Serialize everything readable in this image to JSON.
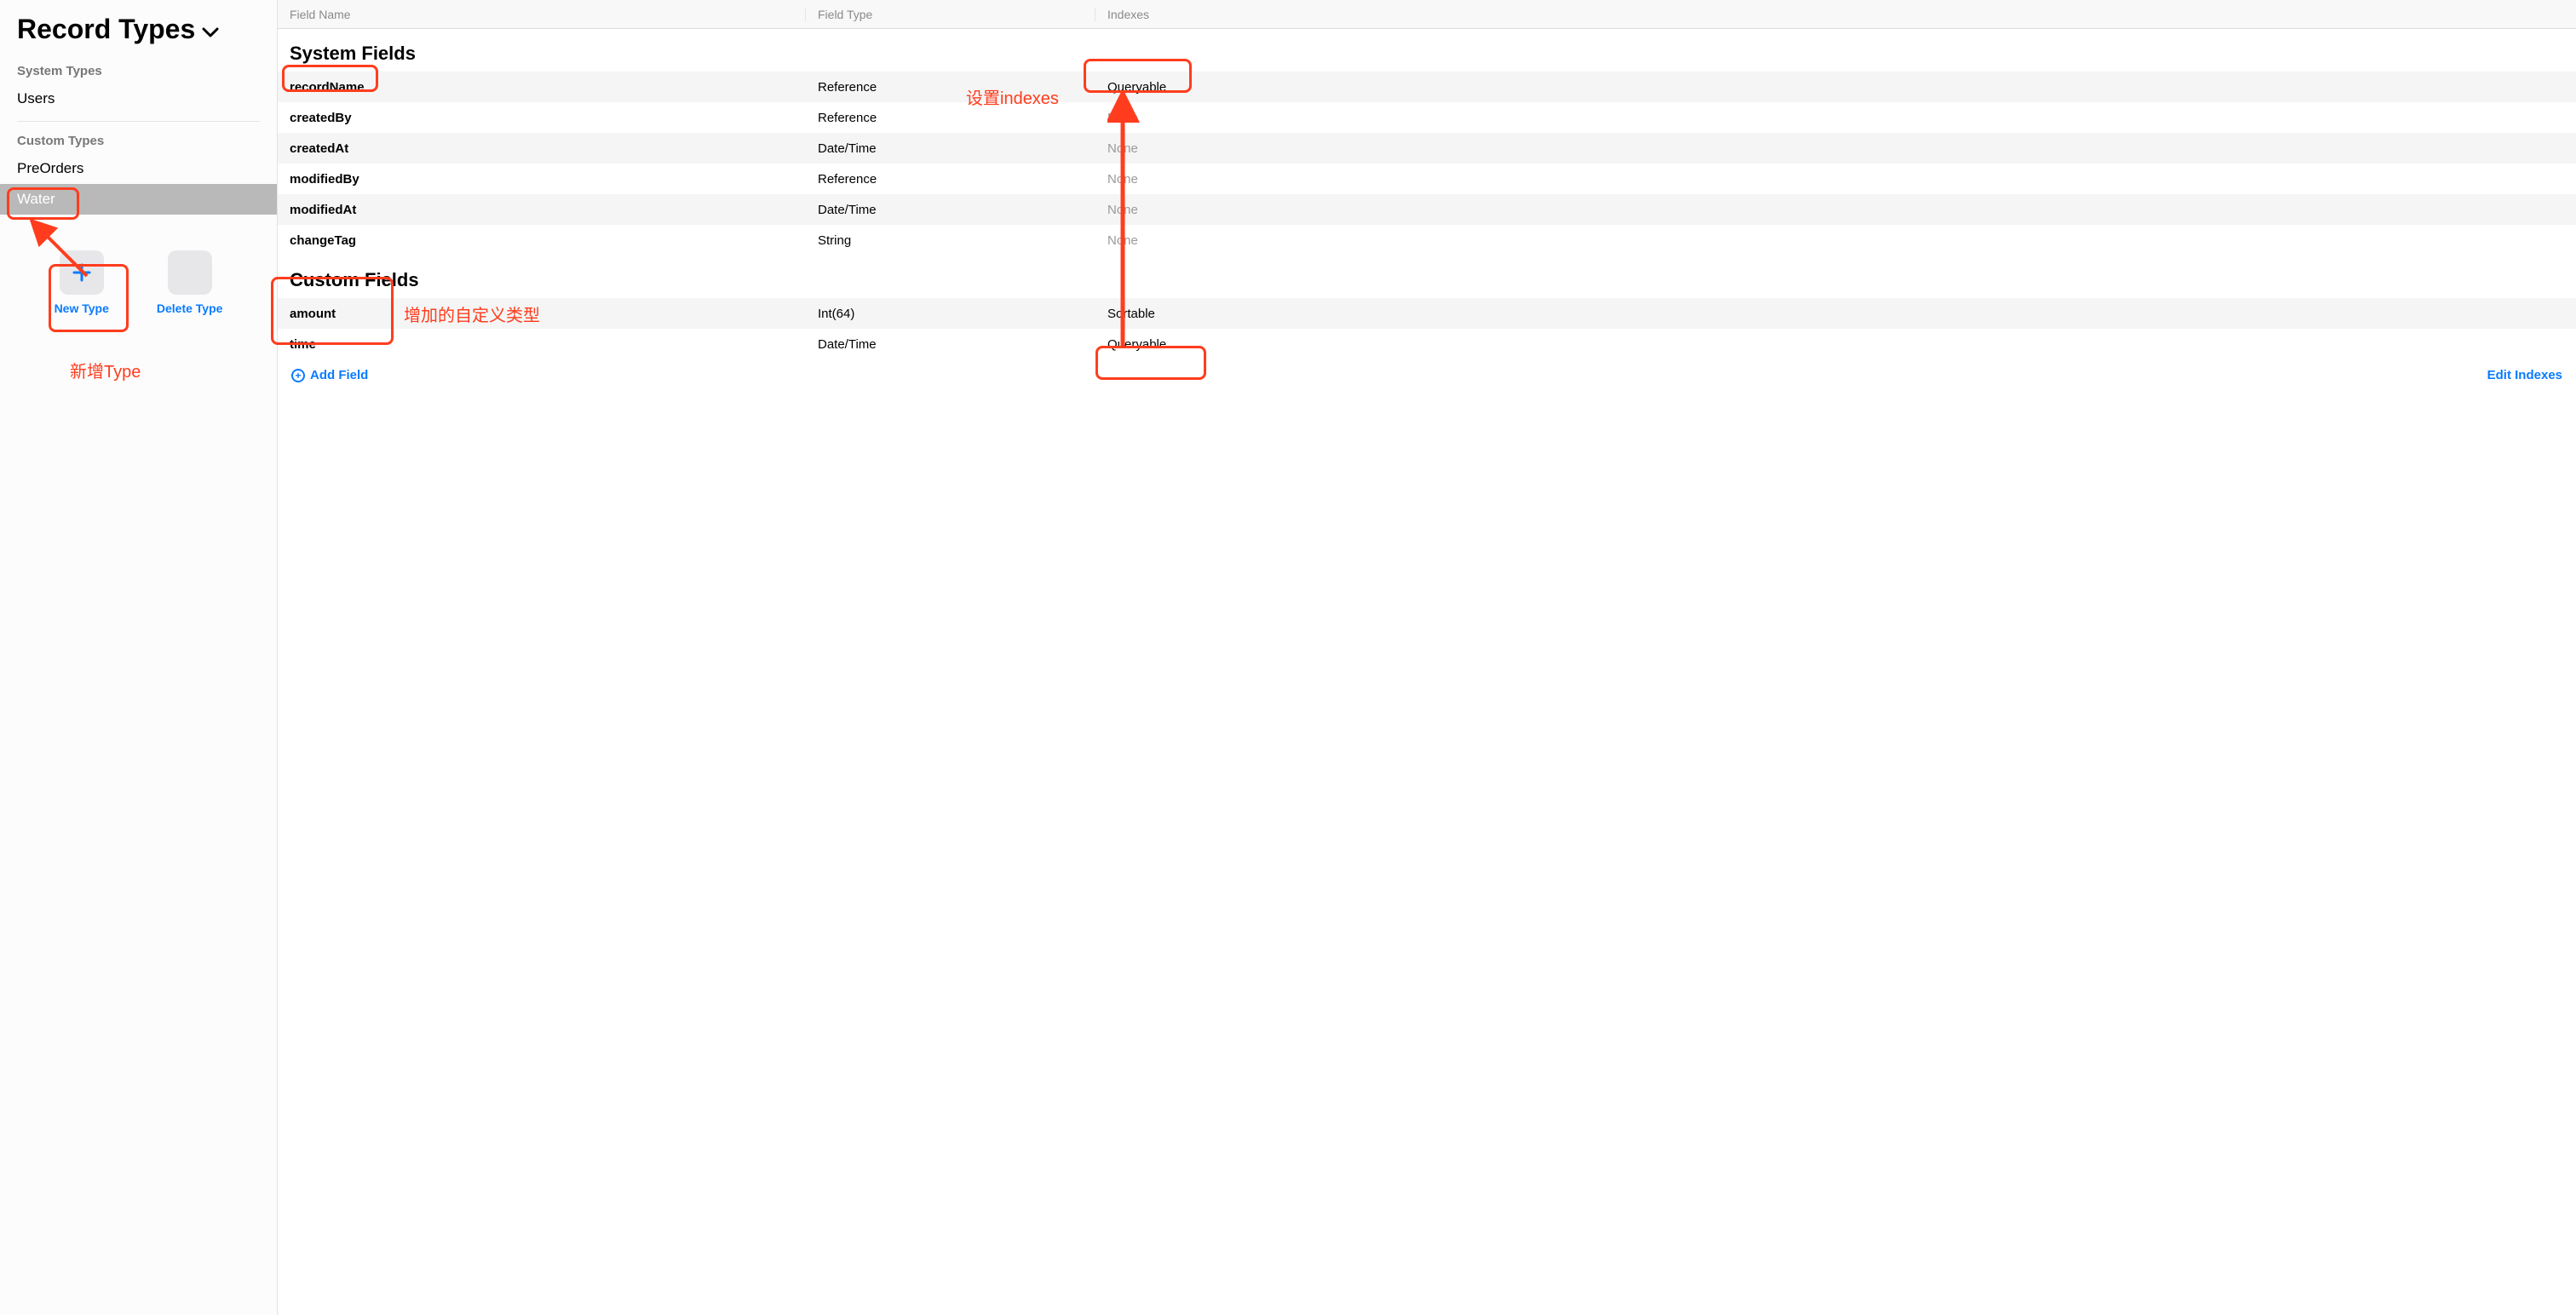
{
  "sidebar": {
    "title": "Record Types",
    "system_types_label": "System Types",
    "system_types": [
      "Users"
    ],
    "custom_types_label": "Custom Types",
    "custom_types": [
      "PreOrders",
      "Water"
    ],
    "selected_type": "Water",
    "actions": {
      "new_type": "New Type",
      "delete_type": "Delete Type"
    }
  },
  "columns": {
    "name": "Field Name",
    "type": "Field Type",
    "indexes": "Indexes"
  },
  "sections": {
    "system": "System Fields",
    "custom": "Custom Fields"
  },
  "system_fields": [
    {
      "name": "recordName",
      "type": "Reference",
      "indexes": "Queryable",
      "muted": false
    },
    {
      "name": "createdBy",
      "type": "Reference",
      "indexes": "None",
      "muted": true
    },
    {
      "name": "createdAt",
      "type": "Date/Time",
      "indexes": "None",
      "muted": true
    },
    {
      "name": "modifiedBy",
      "type": "Reference",
      "indexes": "None",
      "muted": true
    },
    {
      "name": "modifiedAt",
      "type": "Date/Time",
      "indexes": "None",
      "muted": true
    },
    {
      "name": "changeTag",
      "type": "String",
      "indexes": "None",
      "muted": true
    }
  ],
  "custom_fields": [
    {
      "name": "amount",
      "type": "Int(64)",
      "indexes": "Sortable",
      "muted": false
    },
    {
      "name": "time",
      "type": "Date/Time",
      "indexes": "Queryable",
      "muted": false
    }
  ],
  "footer": {
    "add_field": "Add Field",
    "edit_indexes": "Edit Indexes"
  },
  "annotations": {
    "new_type": "新增Type",
    "custom_fields": "增加的自定义类型",
    "set_indexes": "设置indexes"
  }
}
